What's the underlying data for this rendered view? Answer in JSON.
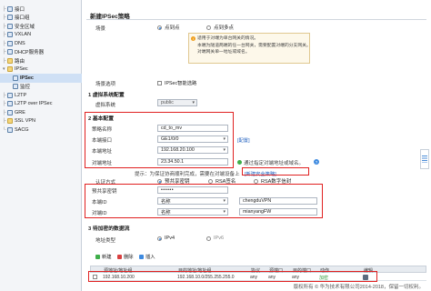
{
  "sidebar": {
    "items": [
      {
        "label": "接口"
      },
      {
        "label": "接口组"
      },
      {
        "label": "安全区域"
      },
      {
        "label": "VXLAN"
      },
      {
        "label": "DNS"
      },
      {
        "label": "DHCP服务器"
      },
      {
        "label": "路由"
      },
      {
        "label": "IPSec"
      },
      {
        "label": "IPSec"
      },
      {
        "label": "监控"
      },
      {
        "label": "L2TP"
      },
      {
        "label": "L2TP over IPSec"
      },
      {
        "label": "GRE"
      },
      {
        "label": "SSL VPN"
      },
      {
        "label": "SACG"
      }
    ]
  },
  "page": {
    "title": "新建IPSec策略"
  },
  "scene": {
    "label": "场景",
    "options": [
      "点到点",
      "点到多点"
    ]
  },
  "note": {
    "lines": [
      "适用于对端为单台网关的情况。",
      "本端为隧道两端的任一台网关，需要配置对端的分支网关。",
      "对端网关单一地址或域名。"
    ]
  },
  "scene_select": {
    "label": "场景选项",
    "checkbox": "IPSec智能选路"
  },
  "sec1": {
    "title": "1 虚拟系统配置",
    "vsys_label": "虚拟系统",
    "vsys_value": "public"
  },
  "sec2": {
    "title": "2 基本配置",
    "policy_name_label": "策略名称",
    "policy_name_value": "cd_to_mv",
    "local_if_label": "本端接口",
    "local_if_value": "GE1/0/0",
    "local_addr_label": "本端地址",
    "local_addr_value": "192.168.20.100",
    "peer_addr_label": "对端地址",
    "peer_addr_value": "23.34.50.1",
    "config_link": "[配置]",
    "peer_status": "通过指定对端地址或域名。",
    "hint_text": "提示：为保证协商顺利完成，需要在对端设备上",
    "hint_link": "[新建安全策略]",
    "auth_label": "认证方式",
    "auth_options": [
      "预共享密钥",
      "RSA签名",
      "RSA数字信封"
    ],
    "psk_label": "预共享密钥",
    "psk_value": "••••••",
    "local_id_label": "本端ID",
    "local_id_type": "名称",
    "local_id_value": "chengduVPN",
    "peer_id_label": "对端ID",
    "peer_id_type": "名称",
    "peer_id_value": "mianyangFW"
  },
  "sec3": {
    "title": "3 待加密的数据流",
    "addr_type_label": "地址类型",
    "addr_options": [
      "IPv4",
      "IPv6"
    ],
    "toolbar": {
      "new": "新建",
      "delete": "删除",
      "insert": "插入"
    },
    "columns": [
      "源地址/地址组",
      "目的地址/地址组",
      "协议",
      "源端口",
      "目的端口",
      "动作",
      "编辑"
    ],
    "rows": [
      {
        "src": "192.168.10.200",
        "dst": "192.168.10.0/255.255.255.0",
        "proto": "any",
        "sport": "any",
        "dport": "any",
        "action": "加密"
      }
    ]
  },
  "footer": {
    "copyright": "版权所有 © 华为技术有限公司2014-2018，保留一切权利。"
  },
  "colors": {
    "highlight": "#e02020",
    "link": "#1f5fbf",
    "accent": "#2f7fd8",
    "action_green": "#2e9c3a"
  }
}
